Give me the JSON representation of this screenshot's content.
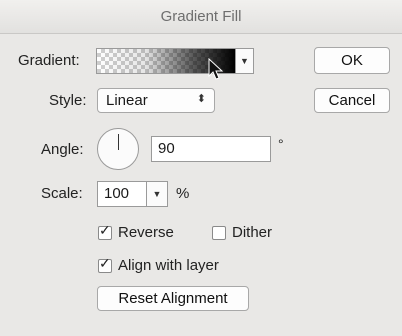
{
  "dialog": {
    "title": "Gradient Fill",
    "gradient_label": "Gradient:",
    "style_label": "Style:",
    "style_value": "Linear",
    "angle_label": "Angle:",
    "angle_value": "90",
    "angle_unit": "°",
    "scale_label": "Scale:",
    "scale_value": "100",
    "scale_unit": "%",
    "reverse_label": "Reverse",
    "reverse_checked": true,
    "dither_label": "Dither",
    "dither_checked": false,
    "align_label": "Align with layer",
    "align_checked": true,
    "reset_label": "Reset Alignment",
    "ok_label": "OK",
    "cancel_label": "Cancel"
  },
  "icons": {
    "dropdown": "triangle-down-icon",
    "select_arrows": "up-down-arrows-icon",
    "check": "checkmark-icon",
    "cursor": "mouse-pointer-icon"
  }
}
